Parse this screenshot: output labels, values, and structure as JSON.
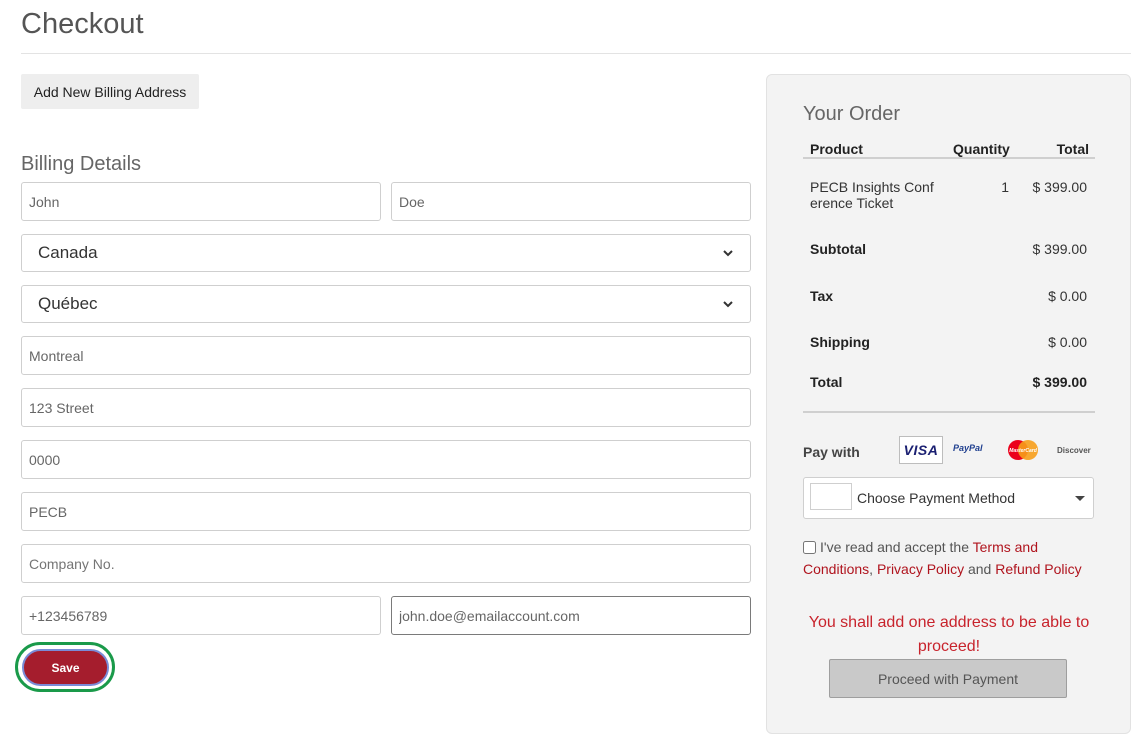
{
  "page": {
    "title": "Checkout"
  },
  "billing": {
    "add_button": "Add New Billing Address",
    "title": "Billing Details",
    "first_name": "John",
    "last_name": "Doe",
    "country": "Canada",
    "province": "Québec",
    "city": "Montreal",
    "street": "123 Street",
    "postal_code": "0000",
    "company": "PECB",
    "company_no_placeholder": "Company No.",
    "phone": "+123456789",
    "email": "john.doe@emailaccount.com",
    "save_button": "Save"
  },
  "order": {
    "title": "Your Order",
    "headers": {
      "product": "Product",
      "quantity": "Quantity",
      "total": "Total"
    },
    "items": [
      {
        "product_line1": "PECB Insights Conf",
        "product_line2": "erence Ticket",
        "quantity": "1",
        "total": "$ 399.00"
      }
    ],
    "subtotal_label": "Subtotal",
    "subtotal_value": "$ 399.00",
    "tax_label": "Tax",
    "tax_value": "$ 0.00",
    "shipping_label": "Shipping",
    "shipping_value": "$ 0.00",
    "total_label": "Total",
    "total_value": "$ 399.00",
    "pay_with": "Pay with",
    "cards": {
      "visa": "VISA",
      "paypal": "PayPal",
      "mastercard": "MasterCard",
      "discover": "Discover"
    },
    "payment_method_placeholder": "Choose Payment Method",
    "terms": {
      "prefix": "I've read and accept the ",
      "terms_link": "Terms and Conditions",
      "sep": ", ",
      "privacy_link": "Privacy Policy",
      "and": " and ",
      "refund_link": "Refund Policy"
    },
    "warning": "You shall add one address to be able to proceed!",
    "proceed_button": "Proceed with Payment"
  },
  "colors": {
    "brand_red": "#a51d2d",
    "warning_red": "#c8232c",
    "focus_green": "#1a9a4a"
  }
}
